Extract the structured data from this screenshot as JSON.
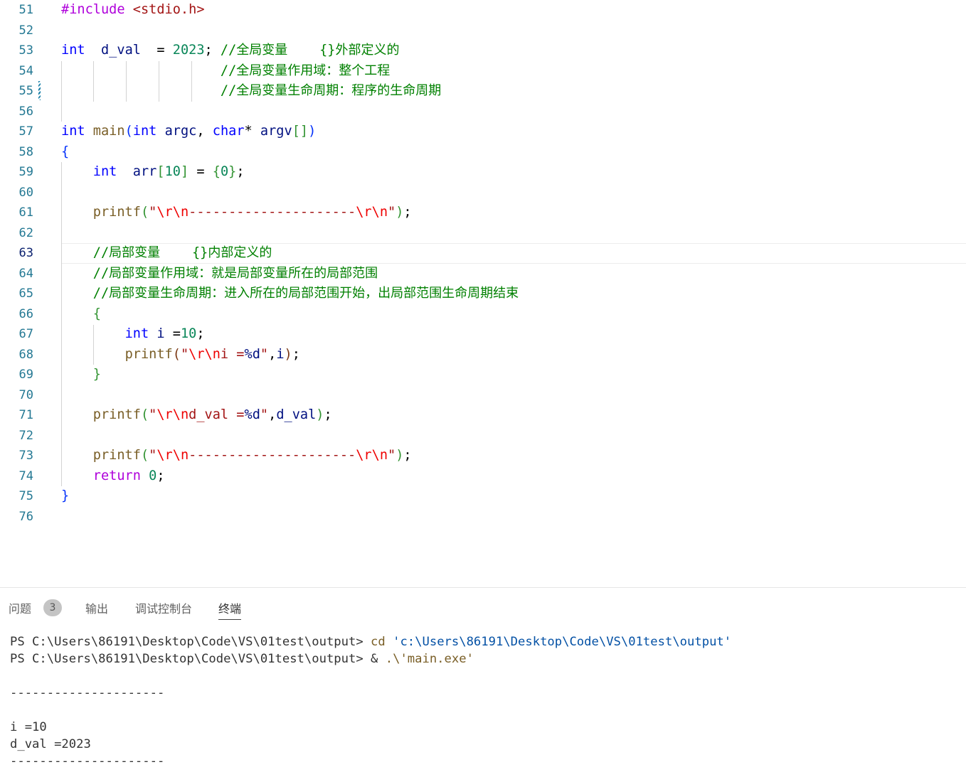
{
  "editor": {
    "lines": [
      {
        "num": "51",
        "tokens": [
          [
            "p",
            "#include"
          ],
          [
            "",
            " "
          ],
          [
            "s",
            "<stdio.h>"
          ]
        ]
      },
      {
        "num": "52",
        "tokens": []
      },
      {
        "num": "53",
        "tokens": [
          [
            "k",
            "int"
          ],
          [
            "",
            "  "
          ],
          [
            "v",
            "d_val"
          ],
          [
            "",
            "  = "
          ],
          [
            "n",
            "2023"
          ],
          [
            "",
            "; "
          ],
          [
            "c",
            "//"
          ],
          [
            "c cj",
            "全局变量"
          ],
          [
            "",
            "    "
          ],
          [
            "c",
            "{}"
          ],
          [
            "c cj",
            "外部定义的"
          ]
        ]
      },
      {
        "num": "54",
        "tokens": [
          [
            "",
            "                    "
          ],
          [
            "c",
            "//"
          ],
          [
            "c cj",
            "全局变量作用域：整个工程"
          ]
        ]
      },
      {
        "num": "55",
        "tokens": [
          [
            "",
            "                    "
          ],
          [
            "c",
            "//"
          ],
          [
            "c cj",
            "全局变量生命周期：程序的生命周期"
          ]
        ]
      },
      {
        "num": "56",
        "tokens": []
      },
      {
        "num": "57",
        "tokens": [
          [
            "k",
            "int"
          ],
          [
            "",
            " "
          ],
          [
            "f",
            "main"
          ],
          [
            "b1",
            "("
          ],
          [
            "k",
            "int"
          ],
          [
            "",
            " "
          ],
          [
            "v",
            "argc"
          ],
          [
            "",
            ", "
          ],
          [
            "k",
            "char"
          ],
          [
            "",
            "* "
          ],
          [
            "v",
            "argv"
          ],
          [
            "b2",
            "[]"
          ],
          [
            "b1",
            ")"
          ]
        ]
      },
      {
        "num": "58",
        "tokens": [
          [
            "b1",
            "{"
          ]
        ]
      },
      {
        "num": "59",
        "tokens": [
          [
            "",
            "    "
          ],
          [
            "k",
            "int"
          ],
          [
            "",
            "  "
          ],
          [
            "v",
            "arr"
          ],
          [
            "b2",
            "["
          ],
          [
            "n",
            "10"
          ],
          [
            "b2",
            "]"
          ],
          [
            "",
            " = "
          ],
          [
            "b2",
            "{"
          ],
          [
            "n",
            "0"
          ],
          [
            "b2",
            "}"
          ],
          [
            "",
            ";"
          ]
        ]
      },
      {
        "num": "60",
        "tokens": []
      },
      {
        "num": "61",
        "tokens": [
          [
            "",
            "    "
          ],
          [
            "f",
            "printf"
          ],
          [
            "b2",
            "("
          ],
          [
            "s",
            "\""
          ],
          [
            "e",
            "\\r\\n"
          ],
          [
            "s",
            "---------------------"
          ],
          [
            "e",
            "\\r\\n"
          ],
          [
            "s",
            "\""
          ],
          [
            "b2",
            ")"
          ],
          [
            "",
            ";"
          ]
        ]
      },
      {
        "num": "62",
        "tokens": []
      },
      {
        "num": "63",
        "tokens": [
          [
            "",
            "    "
          ],
          [
            "c",
            "//"
          ],
          [
            "c cj",
            "局部变量"
          ],
          [
            "",
            "    "
          ],
          [
            "c",
            "{}"
          ],
          [
            "c cj",
            "内部定义的"
          ]
        ]
      },
      {
        "num": "64",
        "tokens": [
          [
            "",
            "    "
          ],
          [
            "c",
            "//"
          ],
          [
            "c cj",
            "局部变量作用域：就是局部变量所在的局部范围"
          ]
        ]
      },
      {
        "num": "65",
        "tokens": [
          [
            "",
            "    "
          ],
          [
            "c",
            "//"
          ],
          [
            "c cj",
            "局部变量生命周期：进入所在的局部范围开始，出局部范围生命周期结束"
          ]
        ]
      },
      {
        "num": "66",
        "tokens": [
          [
            "",
            "    "
          ],
          [
            "b2",
            "{"
          ]
        ]
      },
      {
        "num": "67",
        "tokens": [
          [
            "",
            "        "
          ],
          [
            "k",
            "int"
          ],
          [
            "",
            " "
          ],
          [
            "v",
            "i"
          ],
          [
            "",
            " ="
          ],
          [
            "n",
            "10"
          ],
          [
            "",
            ";"
          ]
        ]
      },
      {
        "num": "68",
        "tokens": [
          [
            "",
            "        "
          ],
          [
            "f",
            "printf"
          ],
          [
            "b3",
            "("
          ],
          [
            "s",
            "\""
          ],
          [
            "e",
            "\\r\\n"
          ],
          [
            "s",
            "i ="
          ],
          [
            "v",
            "%d"
          ],
          [
            "s",
            "\""
          ],
          [
            "",
            ","
          ],
          [
            "v",
            "i"
          ],
          [
            "b3",
            ")"
          ],
          [
            "",
            ";"
          ]
        ]
      },
      {
        "num": "69",
        "tokens": [
          [
            "",
            "    "
          ],
          [
            "b2",
            "}"
          ]
        ]
      },
      {
        "num": "70",
        "tokens": []
      },
      {
        "num": "71",
        "tokens": [
          [
            "",
            "    "
          ],
          [
            "f",
            "printf"
          ],
          [
            "b2",
            "("
          ],
          [
            "s",
            "\""
          ],
          [
            "e",
            "\\r\\n"
          ],
          [
            "s",
            "d_val ="
          ],
          [
            "v",
            "%d"
          ],
          [
            "s",
            "\""
          ],
          [
            "",
            ","
          ],
          [
            "v",
            "d_val"
          ],
          [
            "b2",
            ")"
          ],
          [
            "",
            ";"
          ]
        ]
      },
      {
        "num": "72",
        "tokens": []
      },
      {
        "num": "73",
        "tokens": [
          [
            "",
            "    "
          ],
          [
            "f",
            "printf"
          ],
          [
            "b2",
            "("
          ],
          [
            "s",
            "\""
          ],
          [
            "e",
            "\\r\\n"
          ],
          [
            "s",
            "---------------------"
          ],
          [
            "e",
            "\\r\\n"
          ],
          [
            "s",
            "\""
          ],
          [
            "b2",
            ")"
          ],
          [
            "",
            ";"
          ]
        ]
      },
      {
        "num": "74",
        "tokens": [
          [
            "",
            "    "
          ],
          [
            "p",
            "return"
          ],
          [
            "",
            " "
          ],
          [
            "n",
            "0"
          ],
          [
            "",
            ";"
          ]
        ]
      },
      {
        "num": "75",
        "tokens": [
          [
            "b1",
            "}"
          ]
        ]
      },
      {
        "num": "76",
        "tokens": []
      }
    ],
    "active_line": "63"
  },
  "panel": {
    "tabs": [
      {
        "label": "问题",
        "badge": "3"
      },
      {
        "label": "输出"
      },
      {
        "label": "调试控制台"
      },
      {
        "label": "终端"
      }
    ],
    "active_tab": "终端"
  },
  "terminal": {
    "lines": [
      [
        [
          "",
          "PS C:\\Users\\86191\\Desktop\\Code\\VS\\01test\\output> "
        ],
        [
          "tc",
          "cd"
        ],
        [
          "",
          " "
        ],
        [
          "ts",
          "'c:\\Users\\86191\\Desktop\\Code\\VS\\01test\\output'"
        ]
      ],
      [
        [
          "",
          "PS C:\\Users\\86191\\Desktop\\Code\\VS\\01test\\output> & "
        ],
        [
          "tc",
          ".\\'main.exe'"
        ]
      ],
      [],
      [
        [
          "",
          "---------------------"
        ]
      ],
      [],
      [
        [
          "",
          "i =10"
        ]
      ],
      [
        [
          "",
          "d_val =2023"
        ]
      ],
      [
        [
          "",
          "---------------------"
        ]
      ]
    ]
  },
  "colors": {
    "keyword": "#0000ff",
    "preprocessor": "#af00db",
    "string": "#a31515",
    "escape": "#ee0000",
    "number": "#098658",
    "comment": "#008000",
    "function": "#795e26",
    "variable": "#001080",
    "line_number": "#237893",
    "active_line_number": "#0b216f"
  }
}
